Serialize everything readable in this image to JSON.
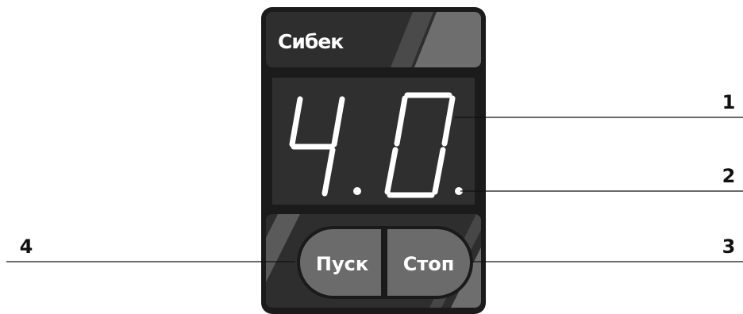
{
  "device": {
    "brand": "Сибек",
    "display": {
      "digits": [
        "4",
        "0"
      ],
      "value": "4.0"
    },
    "buttons": {
      "start_label": "Пуск",
      "stop_label": "Стоп"
    }
  },
  "callouts": [
    {
      "number": "1",
      "target": "display-digits"
    },
    {
      "number": "2",
      "target": "decimal-point"
    },
    {
      "number": "3",
      "target": "stop-button"
    },
    {
      "number": "4",
      "target": "start-button"
    }
  ],
  "colors": {
    "body": "#1b1b1b",
    "panel": "#303030",
    "accent_stripe": "#6e6e6e",
    "button": "#6b6b6b",
    "segment": "#ffffff"
  }
}
